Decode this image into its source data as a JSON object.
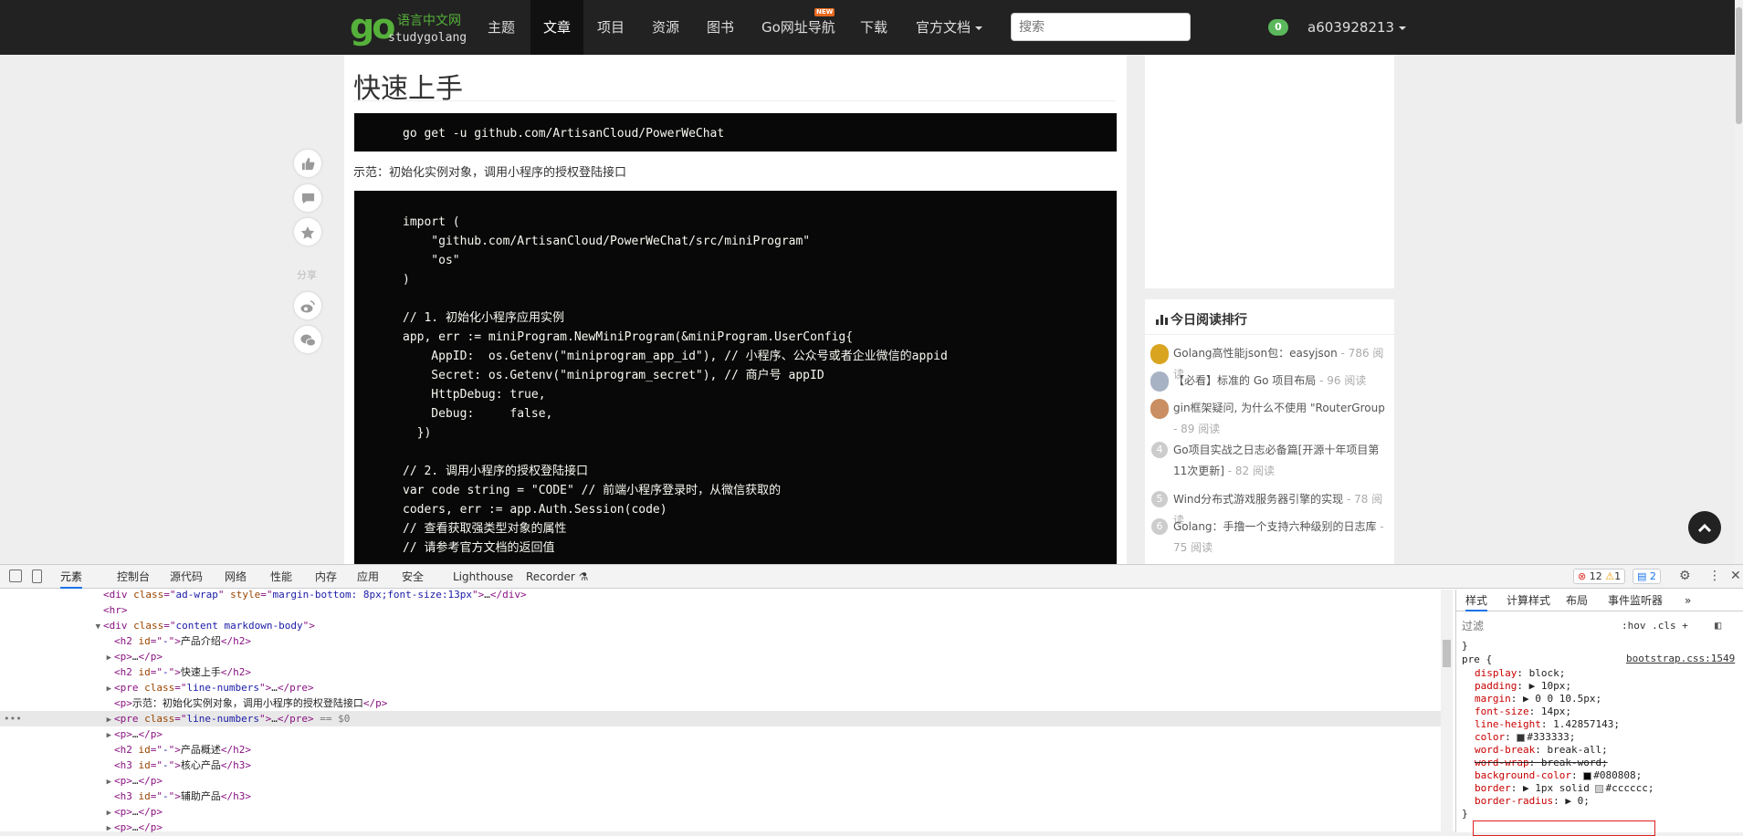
{
  "navbar": {
    "logo": "go",
    "brand_cn": "语言中文网",
    "brand_en": "studygolang",
    "items": [
      {
        "label": "主题"
      },
      {
        "label": "文章"
      },
      {
        "label": "项目"
      },
      {
        "label": "资源"
      },
      {
        "label": "图书"
      },
      {
        "label": "Go网址导航"
      },
      {
        "label": "下载"
      },
      {
        "label": "官方文档"
      }
    ],
    "new_badge": "NEW",
    "search_placeholder": "搜索",
    "message_count": "0",
    "username": "a603928213"
  },
  "article": {
    "section_title": "快速上手",
    "install_cmd": "go get -u github.com/ArtisanCloud/PowerWeChat",
    "demo_caption": "示范：初始化实例对象，调用小程序的授权登陆接口",
    "code_lines": [
      "import (",
      "    \"github.com/ArtisanCloud/PowerWeChat/src/miniProgram\"",
      "    \"os\"",
      ")",
      "",
      "// 1. 初始化小程序应用实例",
      "app, err := miniProgram.NewMiniProgram(&miniProgram.UserConfig{",
      "    AppID:  os.Getenv(\"miniprogram_app_id\"), // 小程序、公众号或者企业微信的appid",
      "    Secret: os.Getenv(\"miniprogram_secret\"), // 商户号 appID",
      "    HttpDebug: true,",
      "    Debug:     false,",
      "  })",
      "",
      "// 2. 调用小程序的授权登陆接口",
      "var code string = \"CODE\" // 前端小程序登录时，从微信获取的",
      "coders, err := app.Auth.Session(code)",
      "// 查看获取强类型对象的属性",
      "// 请参考官方文档的返回值"
    ]
  },
  "rail": {
    "share_label": "分享",
    "icons": [
      "thumbs-up-icon",
      "comment-icon",
      "star-icon",
      "weibo-icon",
      "wechat-icon"
    ]
  },
  "sidebar": {
    "rank_title": "今日阅读排行",
    "rank_items": [
      {
        "num": "1",
        "title": "Golang高性能json包：easyjson",
        "reads": " - 786 阅读"
      },
      {
        "num": "2",
        "title": "【必看】标准的 Go 项目布局",
        "reads": " - 96 阅读"
      },
      {
        "num": "3",
        "title": "gin框架疑问, 为什么不使用 \"RouterGroup",
        "reads": " - 89 阅读"
      },
      {
        "num": "4",
        "title": "Go项目实战之日志必备篇[开源十年项目第11次更新]",
        "reads": " - 82 阅读"
      },
      {
        "num": "5",
        "title": "Wind分布式游戏服务器引擎的实现",
        "reads": " - 78 阅读"
      },
      {
        "num": "6",
        "title": "Golang：手撸一个支持六种级别的日志库",
        "reads": " - 75 阅读"
      }
    ]
  },
  "devtools": {
    "tabs": [
      {
        "label": "元素"
      },
      {
        "label": "控制台"
      },
      {
        "label": "源代码"
      },
      {
        "label": "网络"
      },
      {
        "label": "性能"
      },
      {
        "label": "内存"
      },
      {
        "label": "应用"
      },
      {
        "label": "安全"
      },
      {
        "label": "Lighthouse"
      },
      {
        "label": "Recorder ⚗"
      }
    ],
    "errors": "12",
    "warnings": "1",
    "messages": "2",
    "dom_lines": [
      {
        "indent": 0,
        "arrow": "",
        "html": [
          [
            "tag",
            "<div "
          ],
          [
            "attr",
            "class"
          ],
          [
            "tag",
            "=\""
          ],
          [
            "val",
            "ad-wrap"
          ],
          [
            "tag",
            "\" "
          ],
          [
            "attr",
            "style"
          ],
          [
            "tag",
            "=\""
          ],
          [
            "val",
            "margin-bottom: 8px;font-size:13px"
          ],
          [
            "tag",
            "\">"
          ],
          [
            "txt",
            "…"
          ],
          [
            "tag",
            "</div>"
          ]
        ]
      },
      {
        "indent": 0,
        "arrow": "",
        "html": [
          [
            "tag",
            "<hr>"
          ]
        ]
      },
      {
        "indent": 0,
        "arrow": "▼",
        "html": [
          [
            "tag",
            "<div "
          ],
          [
            "attr",
            "class"
          ],
          [
            "tag",
            "=\""
          ],
          [
            "val",
            "content markdown-body"
          ],
          [
            "tag",
            "\">"
          ]
        ]
      },
      {
        "indent": 1,
        "arrow": "",
        "html": [
          [
            "tag",
            "<h2 "
          ],
          [
            "attr",
            "id"
          ],
          [
            "tag",
            "=\""
          ],
          [
            "val",
            "-"
          ],
          [
            "tag",
            "\">"
          ],
          [
            "txt",
            "产品介绍"
          ],
          [
            "tag",
            "</h2>"
          ]
        ]
      },
      {
        "indent": 1,
        "arrow": "▶",
        "html": [
          [
            "tag",
            "<p>"
          ],
          [
            "txt",
            "…"
          ],
          [
            "tag",
            "</p>"
          ]
        ]
      },
      {
        "indent": 1,
        "arrow": "",
        "html": [
          [
            "tag",
            "<h2 "
          ],
          [
            "attr",
            "id"
          ],
          [
            "tag",
            "=\""
          ],
          [
            "val",
            "-"
          ],
          [
            "tag",
            "\">"
          ],
          [
            "txt",
            "快速上手"
          ],
          [
            "tag",
            "</h2>"
          ]
        ]
      },
      {
        "indent": 1,
        "arrow": "▶",
        "html": [
          [
            "tag",
            "<pre "
          ],
          [
            "attr",
            "class"
          ],
          [
            "tag",
            "=\""
          ],
          [
            "val",
            "line-numbers"
          ],
          [
            "tag",
            "\">"
          ],
          [
            "txt",
            "…"
          ],
          [
            "tag",
            "</pre>"
          ]
        ]
      },
      {
        "indent": 1,
        "arrow": "",
        "html": [
          [
            "tag",
            "<p>"
          ],
          [
            "txt",
            "示范：初始化实例对象，调用小程序的授权登陆接口"
          ],
          [
            "tag",
            "</p>"
          ]
        ]
      },
      {
        "indent": 1,
        "arrow": "▶",
        "selected": true,
        "html": [
          [
            "tag",
            "<pre "
          ],
          [
            "attr",
            "class"
          ],
          [
            "tag",
            "=\""
          ],
          [
            "val",
            "line-numbers"
          ],
          [
            "tag",
            "\">"
          ],
          [
            "txt",
            "…"
          ],
          [
            "tag",
            "</pre>"
          ],
          [
            "sel",
            " == $0"
          ]
        ]
      },
      {
        "indent": 1,
        "arrow": "▶",
        "html": [
          [
            "tag",
            "<p>"
          ],
          [
            "txt",
            "…"
          ],
          [
            "tag",
            "</p>"
          ]
        ]
      },
      {
        "indent": 1,
        "arrow": "",
        "html": [
          [
            "tag",
            "<h2 "
          ],
          [
            "attr",
            "id"
          ],
          [
            "tag",
            "=\""
          ],
          [
            "val",
            "-"
          ],
          [
            "tag",
            "\">"
          ],
          [
            "txt",
            "产品概述"
          ],
          [
            "tag",
            "</h2>"
          ]
        ]
      },
      {
        "indent": 1,
        "arrow": "",
        "html": [
          [
            "tag",
            "<h3 "
          ],
          [
            "attr",
            "id"
          ],
          [
            "tag",
            "=\""
          ],
          [
            "val",
            "-"
          ],
          [
            "tag",
            "\">"
          ],
          [
            "txt",
            "核心产品"
          ],
          [
            "tag",
            "</h3>"
          ]
        ]
      },
      {
        "indent": 1,
        "arrow": "▶",
        "html": [
          [
            "tag",
            "<p>"
          ],
          [
            "txt",
            "…"
          ],
          [
            "tag",
            "</p>"
          ]
        ]
      },
      {
        "indent": 1,
        "arrow": "",
        "html": [
          [
            "tag",
            "<h3 "
          ],
          [
            "attr",
            "id"
          ],
          [
            "tag",
            "=\""
          ],
          [
            "val",
            "-"
          ],
          [
            "tag",
            "\">"
          ],
          [
            "txt",
            "辅助产品"
          ],
          [
            "tag",
            "</h3>"
          ]
        ]
      },
      {
        "indent": 1,
        "arrow": "▶",
        "html": [
          [
            "tag",
            "<p>"
          ],
          [
            "txt",
            "…"
          ],
          [
            "tag",
            "</p>"
          ]
        ]
      },
      {
        "indent": 1,
        "arrow": "▶",
        "html": [
          [
            "tag",
            "<p>"
          ],
          [
            "txt",
            "…"
          ],
          [
            "tag",
            "</p>"
          ]
        ]
      }
    ],
    "styles_tabs": [
      {
        "label": "样式"
      },
      {
        "label": "计算样式"
      },
      {
        "label": "布局"
      },
      {
        "label": "事件监听器"
      },
      {
        "label": "»"
      }
    ],
    "filter_placeholder": "过滤",
    "filter_tools": ":hov  .cls  +",
    "rule_source": "bootstrap.css:1549",
    "rule_selector": "pre {",
    "rule_close": "}",
    "prev_close": "}",
    "declarations": [
      {
        "prop": "display",
        "val": "block;"
      },
      {
        "prop": "padding",
        "val": "▶ 10px;"
      },
      {
        "prop": "margin",
        "val": "▶ 0 0 10.5px;"
      },
      {
        "prop": "font-size",
        "val": "14px;"
      },
      {
        "prop": "line-height",
        "val": "1.42857143;"
      },
      {
        "prop": "color",
        "val": "#333333;",
        "swatch": "#333333"
      },
      {
        "prop": "word-break",
        "val": "break-all;"
      },
      {
        "prop": "word-wrap",
        "val": "break-word;",
        "strike": true
      },
      {
        "prop": "background-color",
        "val": "#080808;",
        "swatch": "#080808"
      },
      {
        "prop": "border",
        "val": "▶ 1px solid ",
        "swatch": "#cccccc",
        "after": "#cccccc;"
      },
      {
        "prop": "border-radius",
        "val": "▶ 0;"
      }
    ]
  }
}
